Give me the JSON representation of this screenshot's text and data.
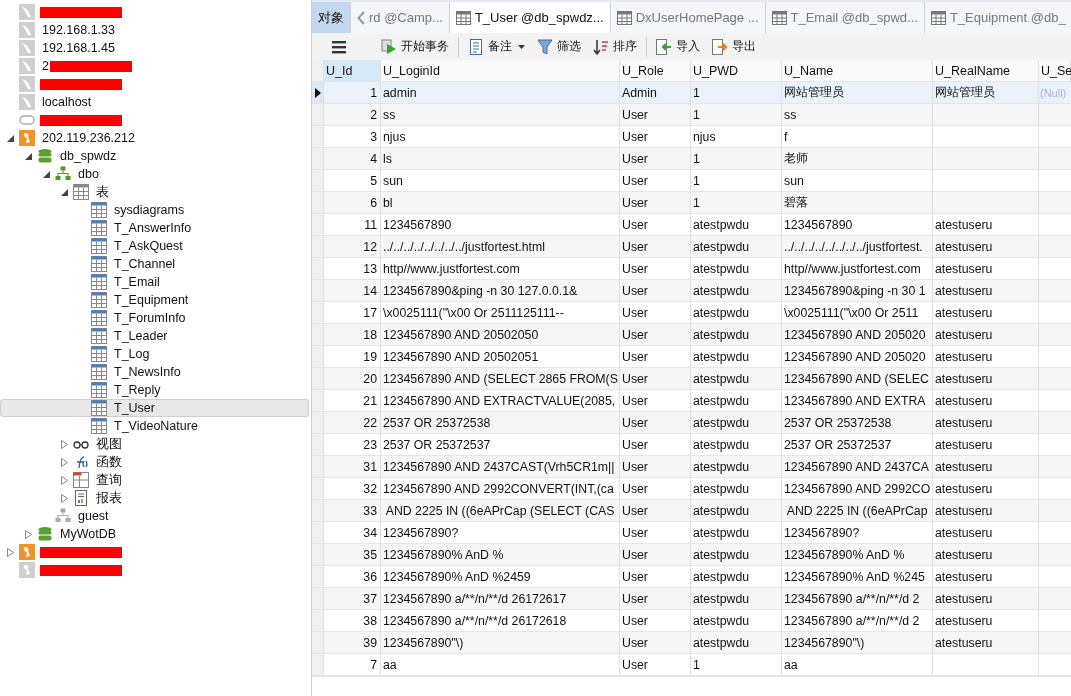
{
  "tree": [
    {
      "kind": "mysql",
      "redacted": true
    },
    {
      "kind": "mysql",
      "label": "192.168.1.33"
    },
    {
      "kind": "mysql",
      "label": "192.168.1.45"
    },
    {
      "kind": "mysql",
      "label": "2",
      "redacted": true
    },
    {
      "kind": "mysql",
      "redacted": true
    },
    {
      "kind": "mysql",
      "label": "localhost"
    },
    {
      "kind": "oracle",
      "redacted": true
    },
    {
      "kind": "sqlserver",
      "label": "202.119.236.212",
      "expanded": true,
      "children": [
        {
          "kind": "database",
          "label": "db_spwdz",
          "expanded": true,
          "children": [
            {
              "kind": "schema",
              "label": "dbo",
              "expanded": true,
              "children": [
                {
                  "kind": "tables",
                  "label": "表",
                  "expanded": true,
                  "children": [
                    {
                      "kind": "table",
                      "label": "sysdiagrams",
                      "selected": false
                    },
                    {
                      "kind": "table",
                      "label": "T_AnswerInfo",
                      "selected": false
                    },
                    {
                      "kind": "table",
                      "label": "T_AskQuest",
                      "selected": false
                    },
                    {
                      "kind": "table",
                      "label": "T_Channel",
                      "selected": false
                    },
                    {
                      "kind": "table",
                      "label": "T_Email",
                      "selected": false
                    },
                    {
                      "kind": "table",
                      "label": "T_Equipment",
                      "selected": false
                    },
                    {
                      "kind": "table",
                      "label": "T_ForumInfo",
                      "selected": false
                    },
                    {
                      "kind": "table",
                      "label": "T_Leader",
                      "selected": false
                    },
                    {
                      "kind": "table",
                      "label": "T_Log",
                      "selected": false
                    },
                    {
                      "kind": "table",
                      "label": "T_NewsInfo",
                      "selected": false
                    },
                    {
                      "kind": "table",
                      "label": "T_Reply",
                      "selected": false
                    },
                    {
                      "kind": "table",
                      "label": "T_User",
                      "selected": true
                    },
                    {
                      "kind": "table",
                      "label": "T_VideoNature",
                      "selected": false
                    }
                  ]
                },
                {
                  "kind": "views",
                  "label": "视图",
                  "expanded": false
                },
                {
                  "kind": "functions",
                  "label": "函数",
                  "expanded": false
                },
                {
                  "kind": "queries",
                  "label": "查询",
                  "expanded": false
                },
                {
                  "kind": "reports",
                  "label": "报表",
                  "expanded": false
                }
              ]
            },
            {
              "kind": "schema_grey",
              "label": "guest"
            }
          ]
        },
        {
          "kind": "database",
          "label": "MyWotDB",
          "expanded": false
        }
      ]
    },
    {
      "kind": "sqlserver",
      "redacted": true,
      "expanded": false
    },
    {
      "kind": "sqlserver_grey",
      "redacted": true
    }
  ],
  "tabs": [
    {
      "kind": "objects",
      "label": "对象",
      "selected": false
    },
    {
      "kind": "scrolled",
      "label": "rd @Camp...",
      "selected": false
    },
    {
      "kind": "table",
      "label": "T_User @db_spwdz...",
      "selected": true
    },
    {
      "kind": "table",
      "label": "DxUserHomePage ...",
      "selected": false
    },
    {
      "kind": "table",
      "label": "T_Email @db_spwd...",
      "selected": false
    },
    {
      "kind": "table",
      "label": "T_Equipment @db_",
      "selected": false
    }
  ],
  "toolbar": [
    {
      "kind": "menu"
    },
    {
      "kind": "transaction",
      "label": "开始事务"
    },
    {
      "kind": "memo",
      "label": "备注",
      "dropdown": true
    },
    {
      "kind": "filter",
      "label": "筛选"
    },
    {
      "kind": "sort",
      "label": "排序"
    },
    {
      "kind": "import",
      "label": "导入"
    },
    {
      "kind": "export",
      "label": "导出"
    }
  ],
  "table": {
    "columns": [
      "U_Id",
      "U_LoginId",
      "U_Role",
      "U_PWD",
      "U_Name",
      "U_RealName",
      "U_Se"
    ],
    "rows": [
      {
        "selected": true,
        "id": "1",
        "login_id": "admin",
        "role": "Admin",
        "pwd": "1",
        "name": "网站管理员",
        "real_name": "网站管理员",
        "sex": "(Null)"
      },
      {
        "selected": false,
        "id": "2",
        "login_id": "ss",
        "role": "User",
        "pwd": "1",
        "name": "ss"
      },
      {
        "selected": false,
        "id": "3",
        "login_id": "njus",
        "role": "User",
        "pwd": "njus",
        "name": "f"
      },
      {
        "selected": false,
        "id": "4",
        "login_id": "ls",
        "role": "User",
        "pwd": "1",
        "name": "老师"
      },
      {
        "selected": false,
        "id": "5",
        "login_id": "sun",
        "role": "User",
        "pwd": "1",
        "name": "sun"
      },
      {
        "selected": false,
        "id": "6",
        "login_id": "bl",
        "role": "User",
        "pwd": "1",
        "name": "碧落"
      },
      {
        "selected": false,
        "id": "11",
        "login_id": "1234567890",
        "role": "User",
        "pwd": "atestpwdu",
        "name": "1234567890",
        "real_name": "atestuseru"
      },
      {
        "selected": false,
        "id": "12",
        "login_id": "../../../../../../../../justfortest.html",
        "role": "User",
        "pwd": "atestpwdu",
        "name": "../../../../../../../../justfortest.",
        "real_name": "atestuseru"
      },
      {
        "selected": false,
        "id": "13",
        "login_id": "http//www.justfortest.com",
        "role": "User",
        "pwd": "atestpwdu",
        "name": "http//www.justfortest.com",
        "real_name": "atestuseru"
      },
      {
        "selected": false,
        "id": "14",
        "login_id": "1234567890&ping -n 30 127.0.0.1&",
        "role": "User",
        "pwd": "atestpwdu",
        "name": "1234567890&ping -n 30 1",
        "real_name": "atestuseru"
      },
      {
        "selected": false,
        "id": "17",
        "login_id": "\\x0025111(\"\\x00 Or 2511125111--",
        "role": "User",
        "pwd": "atestpwdu",
        "name": "\\x0025111(\"\\x00 Or 2511",
        "real_name": "atestuseru"
      },
      {
        "selected": false,
        "id": "18",
        "login_id": "1234567890 AND 20502050",
        "role": "User",
        "pwd": "atestpwdu",
        "name": "1234567890 AND 205020",
        "real_name": "atestuseru"
      },
      {
        "selected": false,
        "id": "19",
        "login_id": "1234567890 AND 20502051",
        "role": "User",
        "pwd": "atestpwdu",
        "name": "1234567890 AND 205020",
        "real_name": "atestuseru"
      },
      {
        "selected": false,
        "id": "20",
        "login_id": "1234567890 AND (SELECT 2865 FROM(S",
        "role": "User",
        "pwd": "atestpwdu",
        "name": "1234567890 AND (SELEC",
        "real_name": "atestuseru"
      },
      {
        "selected": false,
        "id": "21",
        "login_id": "1234567890 AND EXTRACTVALUE(2085,",
        "role": "User",
        "pwd": "atestpwdu",
        "name": "1234567890 AND EXTRA",
        "real_name": "atestuseru"
      },
      {
        "selected": false,
        "id": "22",
        "login_id": "2537 OR 25372538",
        "role": "User",
        "pwd": "atestpwdu",
        "name": "2537 OR 25372538",
        "real_name": "atestuseru"
      },
      {
        "selected": false,
        "id": "23",
        "login_id": "2537 OR 25372537",
        "role": "User",
        "pwd": "atestpwdu",
        "name": "2537 OR 25372537",
        "real_name": "atestuseru"
      },
      {
        "selected": false,
        "id": "31",
        "login_id": "1234567890 AND 2437CAST(Vrh5CR1m||",
        "role": "User",
        "pwd": "atestpwdu",
        "name": "1234567890 AND 2437CA",
        "real_name": "atestuseru"
      },
      {
        "selected": false,
        "id": "32",
        "login_id": "1234567890 AND 2992CONVERT(INT,(ca",
        "role": "User",
        "pwd": "atestpwdu",
        "name": "1234567890 AND 2992CO",
        "real_name": "atestuseru"
      },
      {
        "selected": false,
        "id": "33",
        "login_id": " AND 2225 IN ((6eAPrCap (SELECT (CAS",
        "role": "User",
        "pwd": "atestpwdu",
        "name": " AND 2225 IN ((6eAPrCap",
        "real_name": "atestuseru"
      },
      {
        "selected": false,
        "id": "34",
        "login_id": "1234567890?",
        "role": "User",
        "pwd": "atestpwdu",
        "name": "1234567890?",
        "real_name": "atestuseru"
      },
      {
        "selected": false,
        "id": "35",
        "login_id": "1234567890% AnD %",
        "role": "User",
        "pwd": "atestpwdu",
        "name": "1234567890% AnD %",
        "real_name": "atestuseru"
      },
      {
        "selected": false,
        "id": "36",
        "login_id": "1234567890% AnD %2459",
        "role": "User",
        "pwd": "atestpwdu",
        "name": "1234567890% AnD %245",
        "real_name": "atestuseru"
      },
      {
        "selected": false,
        "id": "37",
        "login_id": "1234567890 a/**/n/**/d 26172617",
        "role": "User",
        "pwd": "atestpwdu",
        "name": "1234567890 a/**/n/**/d 2",
        "real_name": "atestuseru"
      },
      {
        "selected": false,
        "id": "38",
        "login_id": "1234567890 a/**/n/**/d 26172618",
        "role": "User",
        "pwd": "atestpwdu",
        "name": "1234567890 a/**/n/**/d 2",
        "real_name": "atestuseru"
      },
      {
        "selected": false,
        "id": "39",
        "login_id": "1234567890\"\\)",
        "role": "User",
        "pwd": "atestpwdu",
        "name": "1234567890\"\\)",
        "real_name": "atestuseru"
      },
      {
        "selected": false,
        "id": "7",
        "login_id": "aa",
        "role": "User",
        "pwd": "1",
        "name": "aa"
      }
    ]
  }
}
